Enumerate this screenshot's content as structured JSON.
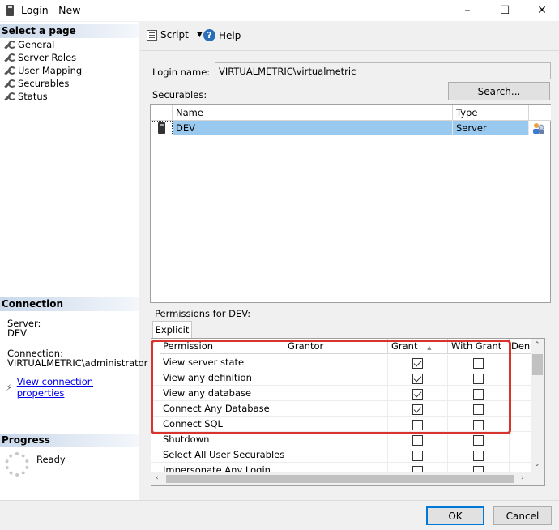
{
  "window": {
    "title": "Login - New",
    "minimize": "–",
    "maximize": "☐",
    "close": "✕"
  },
  "left": {
    "select_page_header": "Select a page",
    "pages": [
      "General",
      "Server Roles",
      "User Mapping",
      "Securables",
      "Status"
    ],
    "connection_header": "Connection",
    "server_label": "Server:",
    "server_value": "DEV",
    "connection_label": "Connection:",
    "connection_value": "VIRTUALMETRIC\\administrator",
    "view_connection_link": "View connection properties",
    "progress_header": "Progress",
    "progress_status": "Ready"
  },
  "toolbar": {
    "script_label": "Script",
    "dropdown_arrow": "▼",
    "help_label": "Help"
  },
  "login": {
    "login_name_label": "Login name:",
    "login_name_value": "VIRTUALMETRIC\\virtualmetric",
    "securables_label": "Securables:",
    "search_button": "Search..."
  },
  "securables_table": {
    "columns": [
      "Name",
      "Type"
    ],
    "rows": [
      {
        "name": "DEV",
        "type": "Server"
      }
    ]
  },
  "permissions": {
    "label": "Permissions for DEV:",
    "tab": "Explicit",
    "columns": [
      "Permission",
      "Grantor",
      "Grant",
      "With Grant",
      "Deny"
    ],
    "sort_indicator": "▲",
    "rows": [
      {
        "permission": "View server state",
        "grantor": "",
        "grant": true,
        "with_grant": false
      },
      {
        "permission": "View any definition",
        "grantor": "",
        "grant": true,
        "with_grant": false
      },
      {
        "permission": "View any database",
        "grantor": "",
        "grant": true,
        "with_grant": false
      },
      {
        "permission": "Connect Any Database",
        "grantor": "",
        "grant": true,
        "with_grant": false
      },
      {
        "permission": "Connect SQL",
        "grantor": "",
        "grant": false,
        "with_grant": false
      },
      {
        "permission": "Shutdown",
        "grantor": "",
        "grant": false,
        "with_grant": false
      },
      {
        "permission": "Select All User Securables",
        "grantor": "",
        "grant": false,
        "with_grant": false
      },
      {
        "permission": "Impersonate Any Login",
        "grantor": "",
        "grant": false,
        "with_grant": false
      }
    ]
  },
  "footer": {
    "ok": "OK",
    "cancel": "Cancel"
  },
  "colors": {
    "highlight": "#d9342b",
    "selection": "#99c9ef",
    "link": "#0000ee"
  }
}
